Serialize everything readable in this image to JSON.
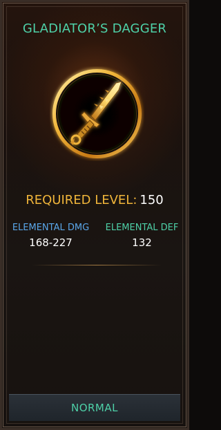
{
  "item": {
    "name": "GLADIATOR’S DAGGER",
    "icon": "dagger-icon",
    "required_level_label": "REQUIRED LEVEL:",
    "required_level_value": "150",
    "rarity": "NORMAL"
  },
  "stats": {
    "elemental_dmg": {
      "label": "ELEMENTAL DMG",
      "value": "168-227"
    },
    "elemental_def": {
      "label": "ELEMENTAL DEF",
      "value": "132"
    }
  },
  "colors": {
    "name": "#4ed1a8",
    "required_level": "#f0b53a",
    "elemental_dmg": "#5aa7ea",
    "elemental_def": "#4ed1a8",
    "emblem_gold": "#e8b53a"
  }
}
